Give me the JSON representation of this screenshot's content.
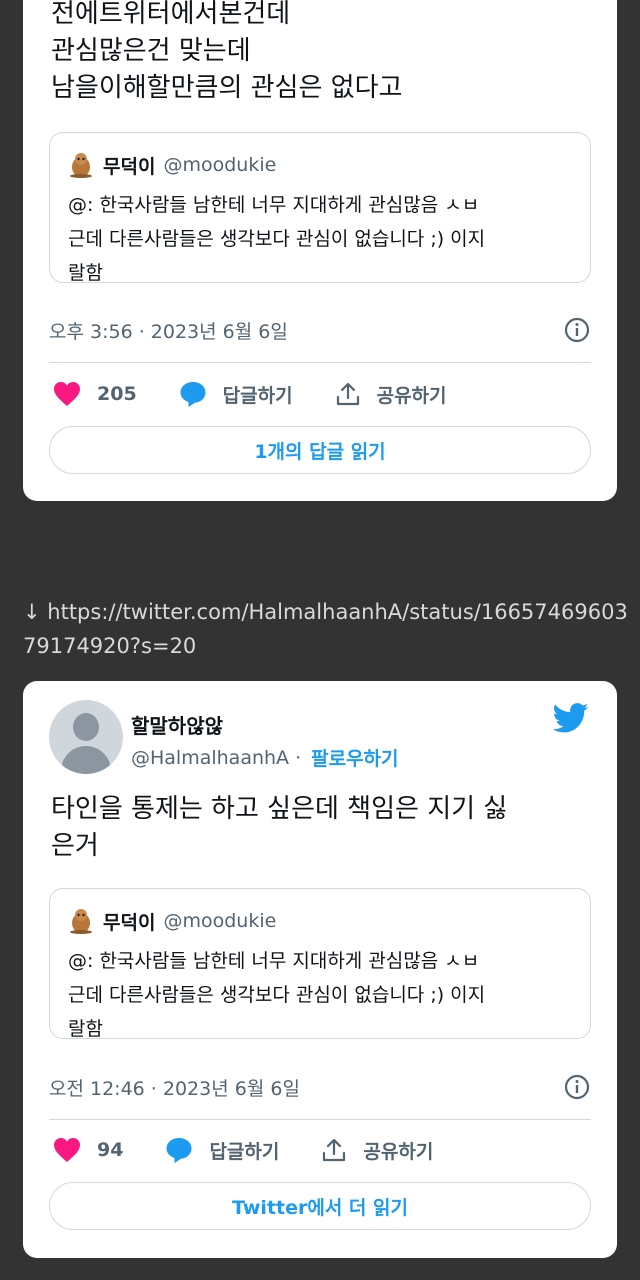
{
  "tweet1": {
    "text": "전에트위터에서본건데\n관심많은건 맞는데\n남을이해할만큼의 관심은 없다고",
    "quote": {
      "name": "무덕이",
      "handle": "@moodukie",
      "text": "@: 한국사람들 남한테 너무 지대하게 관심많음 ㅅㅂ\n근데 다른사람들은 생각보다 관심이 없습니다 ;) 이지\n랄함"
    },
    "timestamp": "오후 3:56 · 2023년 6월 6일",
    "likes": "205",
    "reply_label": "답글하기",
    "share_label": "공유하기",
    "read_replies": "1개의 답글 읽기"
  },
  "link": "↓ https://twitter.com/HalmalhaanhA/status/1665746960379174920?s=20",
  "tweet2": {
    "name": "할말하않않",
    "handle": "@HalmalhaanhA",
    "separator": "·",
    "follow_label": "팔로우하기",
    "text": "타인을 통제는 하고 싶은데 책임은 지기 싫\n은거",
    "quote": {
      "name": "무덕이",
      "handle": "@moodukie",
      "text": "@: 한국사람들 남한테 너무 지대하게 관심많음 ㅅㅂ\n근데 다른사람들은 생각보다 관심이 없습니다 ;) 이지\n랄함"
    },
    "timestamp": "오전 12:46 · 2023년 6월 6일",
    "likes": "94",
    "reply_label": "답글하기",
    "share_label": "공유하기",
    "read_more": "Twitter에서 더 읽기"
  },
  "colors": {
    "background": "#333333",
    "accent": "#1d9bf0",
    "heart": "#f91880",
    "text": "#0f1419",
    "muted": "#536471"
  },
  "icons": [
    "quote-avatar-icon",
    "info-icon",
    "heart-icon",
    "reply-bubble-icon",
    "share-icon",
    "twitter-bird-icon",
    "default-avatar"
  ]
}
